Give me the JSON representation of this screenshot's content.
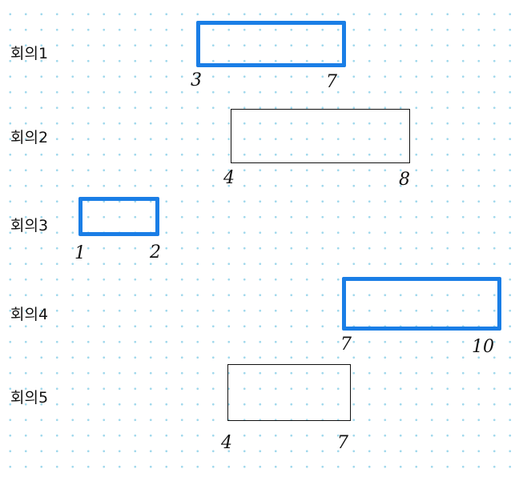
{
  "meetings": [
    {
      "label": "회의1",
      "start": "3",
      "end": "7",
      "selected": true
    },
    {
      "label": "회의2",
      "start": "4",
      "end": "8",
      "selected": false
    },
    {
      "label": "회의3",
      "start": "1",
      "end": "2",
      "selected": true
    },
    {
      "label": "회의4",
      "start": "7",
      "end": "10",
      "selected": true
    },
    {
      "label": "회의5",
      "start": "4",
      "end": "7",
      "selected": false
    }
  ],
  "colors": {
    "selected_border": "#1a7ee6",
    "default_border": "#111111",
    "grid_dot": "#9fd8ec"
  }
}
